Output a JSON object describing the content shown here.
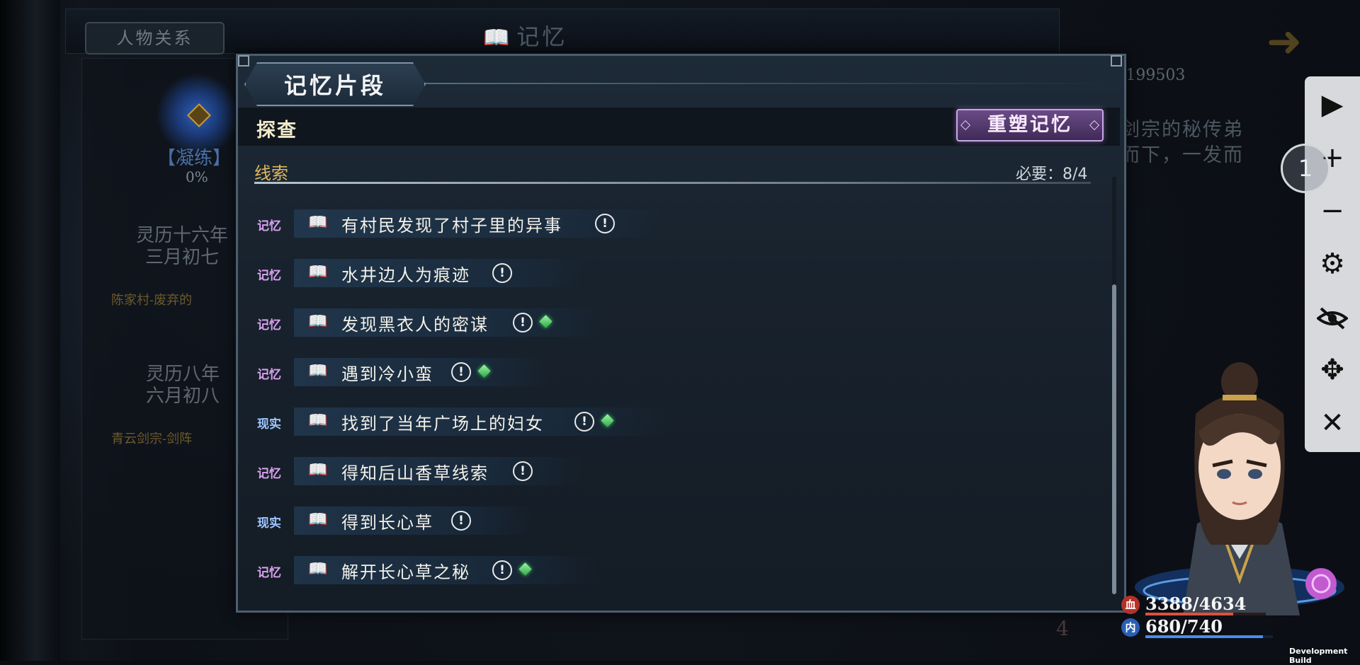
{
  "background": {
    "relation_tab": "人物关系",
    "memory_title": "记忆",
    "condense_label": "【凝练】",
    "condense_percent": "0%",
    "timeline": [
      {
        "date_line1": "灵历十六年",
        "date_line2": "三月初七",
        "location": "陈家村-废弃的"
      },
      {
        "date_line1": "灵历八年",
        "date_line2": "六月初八",
        "location": "青云剑宗-剑阵"
      }
    ],
    "right_id": "/199503",
    "right_desc_line1": "剑宗的秘传弟",
    "right_desc_line2": "而下，一发而",
    "page_number": "4"
  },
  "panel": {
    "title": "记忆片段",
    "section": "探查",
    "reshape_button": "重塑记忆",
    "clue_label": "线索",
    "requirement": "必要：8/4",
    "clues": [
      {
        "tag": "记忆",
        "type": "memory",
        "text": "有村民发现了村子里的异事",
        "alert": "!",
        "gem": false
      },
      {
        "tag": "记忆",
        "type": "memory",
        "text": "水井边人为痕迹",
        "alert": "!",
        "gem": false
      },
      {
        "tag": "记忆",
        "type": "memory",
        "text": "发现黑衣人的密谋",
        "alert": "!",
        "gem": true
      },
      {
        "tag": "记忆",
        "type": "memory",
        "text": "遇到冷小蛮",
        "alert": "!",
        "gem": true
      },
      {
        "tag": "现实",
        "type": "reality",
        "text": "找到了当年广场上的妇女",
        "alert": "!",
        "gem": true
      },
      {
        "tag": "记忆",
        "type": "memory",
        "text": "得知后山香草线索",
        "alert": "!",
        "gem": false
      },
      {
        "tag": "现实",
        "type": "reality",
        "text": "得到长心草",
        "alert": "!",
        "gem": false
      },
      {
        "tag": "记忆",
        "type": "memory",
        "text": "解开长心草之秘",
        "alert": "!",
        "gem": true
      }
    ]
  },
  "toolbar": {
    "icons": [
      "play-icon",
      "plus-icon",
      "minus-icon",
      "gear-icon",
      "eye-hidden-icon",
      "move-icon",
      "close-icon"
    ],
    "floating_label": "1"
  },
  "character": {
    "hp_icon": "血",
    "hp": "3388/4634",
    "hp_fraction": 0.73,
    "mp_icon": "内",
    "mp": "680/740",
    "mp_fraction": 0.92
  },
  "footer": {
    "dev_build": "Development Build"
  },
  "colors": {
    "memory_tag": "#d9a2f0",
    "reality_tag": "#9ec6ff",
    "clue_label": "#e0b860",
    "reshape_btn": "#6a4b86",
    "gem": "#3ed05a",
    "hp_bar": "#e0503a",
    "mp_bar": "#4a8cf0"
  }
}
